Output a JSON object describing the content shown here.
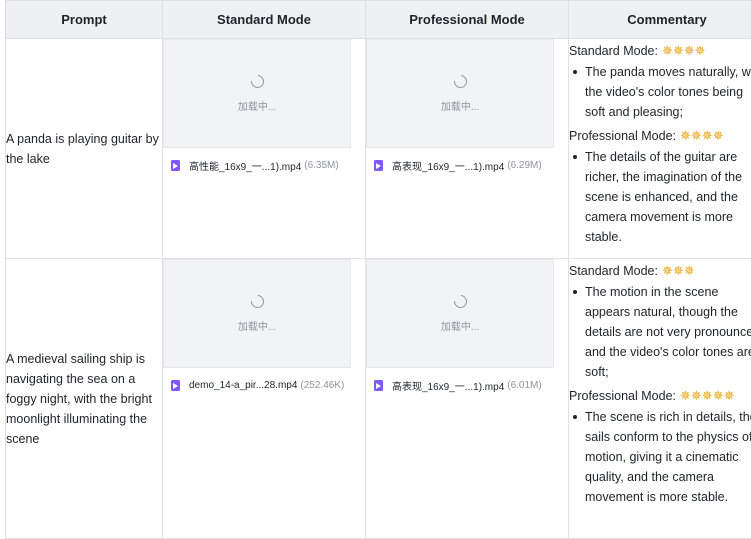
{
  "table": {
    "headers": [
      "Prompt",
      "Standard Mode",
      "Professional Mode",
      "Commentary"
    ],
    "rows": [
      {
        "prompt": "A panda is playing guitar by the lake",
        "standard_video": {
          "loading": "加载中...",
          "file_name": "高性能_16x9_一...1).mp4",
          "file_size": "(6.35M)"
        },
        "professional_video": {
          "loading": "加载中...",
          "file_name": "高表现_16x9_一...1).mp4",
          "file_size": "(6.29M)"
        },
        "commentary": {
          "standard_label": "Standard Mode:",
          "standard_stars": "✵✵✵✵",
          "standard_points": [
            "The panda moves naturally, with the video's color tones being soft and pleasing;"
          ],
          "professional_label": "Professional Mode:",
          "professional_stars": "✵✵✵✵",
          "professional_points": [
            "The details of the guitar are richer, the imagination of the scene is enhanced, and the camera movement is more stable."
          ]
        }
      },
      {
        "prompt": "A medieval sailing ship is navigating the sea on a foggy night, with the bright moonlight illuminating the scene",
        "standard_video": {
          "loading": "加载中...",
          "file_name": "demo_14-a_pir...28.mp4",
          "file_size": "(252.46K)"
        },
        "professional_video": {
          "loading": "加载中...",
          "file_name": "高表现_16x9_一...1).mp4",
          "file_size": "(6.01M)"
        },
        "commentary": {
          "standard_label": "Standard Mode:",
          "standard_stars": "✵✵✵",
          "standard_points": [
            "The motion in the scene appears natural, though the details are not very pronounced, and the video's color tones are soft;"
          ],
          "professional_label": "Professional Mode:",
          "professional_stars": "✵✵✵✵✵",
          "professional_points": [
            "The scene is rich in details, the sails conform to the physics of motion, giving it a cinematic quality, and the camera movement is more stable."
          ]
        }
      }
    ]
  },
  "colors": {
    "header_bg": "#eff0f1",
    "border": "#dee0e3",
    "star": "#e8a413",
    "file_icon": "#7f59ff"
  },
  "icons": {
    "spinner": "loading-spinner-icon",
    "file": "video-file-icon",
    "star": "star-icon",
    "bullet": "bullet-icon"
  }
}
